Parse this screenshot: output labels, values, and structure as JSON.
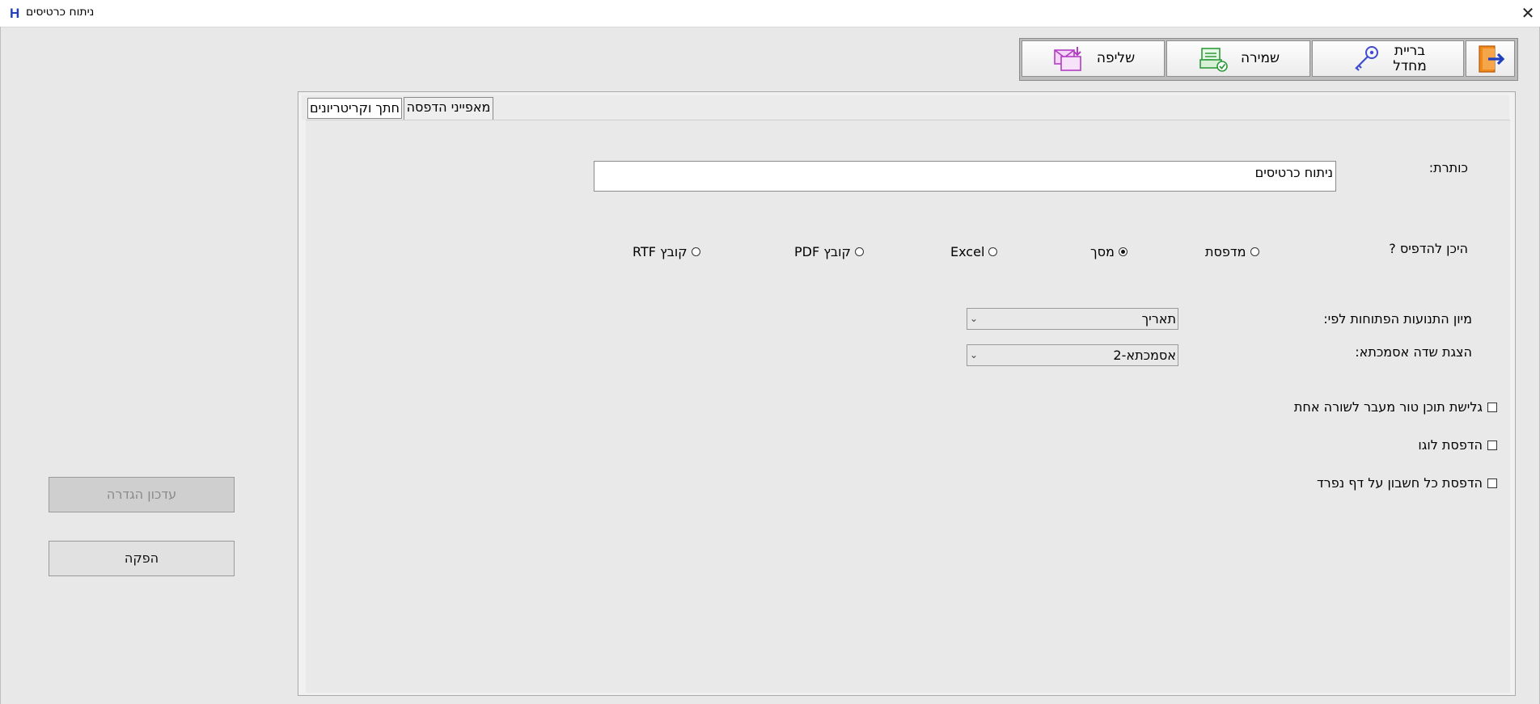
{
  "window": {
    "title": "ניתוח כרטיסים",
    "app_icon": "H"
  },
  "toolbar": {
    "load_label": "שליפה",
    "save_label": "שמירה",
    "password_label_line1": "בריית",
    "password_label_line2": "מחדל"
  },
  "tabs": {
    "active": "מאפייני הדפסה",
    "inactive": "חתך וקריטריונים"
  },
  "form": {
    "title_label": "כותרת:",
    "title_value": "ניתוח כרטיסים",
    "where_label": "היכן להדפיס ?",
    "print_options": {
      "printer": "מדפסת",
      "screen": "מסך",
      "excel": "Excel",
      "pdf": "קובץ PDF",
      "rtf": "קובץ RTF",
      "selected": "מסך"
    },
    "sort_label": "מיון התנועות הפתוחות לפי:",
    "sort_value": "תאריך",
    "ref_label": "הצגת שדה אסמכתא:",
    "ref_value": "אסמכתא-2",
    "checkboxes": {
      "overflow": "גלישת תוכן טור מעבר לשורה אחת",
      "logo": "הדפסת לוגו",
      "separate_page": "הדפסת כל חשבון על דף נפרד"
    }
  },
  "side": {
    "update_label": "עדכון הגדרה",
    "run_label": "הפקה"
  }
}
